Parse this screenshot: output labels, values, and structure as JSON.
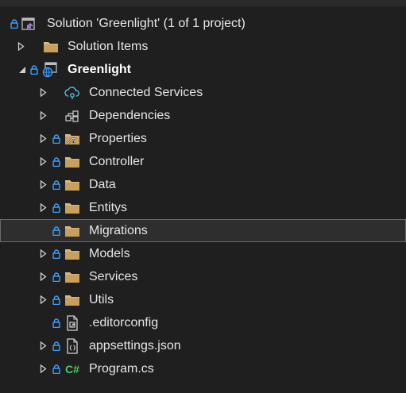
{
  "colors": {
    "background": "#1f1f1f",
    "folder": "#dcb67a",
    "lock": "#3f9fff",
    "csharp": "#4ec96b",
    "solution_accent": "#a87ce8",
    "text": "#e6e6e6"
  },
  "tree": {
    "solution": {
      "label": "Solution 'Greenlight' (1 of 1 project)",
      "icon": "solution-icon"
    },
    "solution_items": {
      "label": "Solution Items",
      "icon": "folder-icon"
    },
    "project": {
      "label": "Greenlight",
      "icon": "web-project-icon"
    },
    "children": [
      {
        "label": "Connected Services",
        "icon": "connected-services-icon"
      },
      {
        "label": "Dependencies",
        "icon": "dependencies-icon"
      },
      {
        "label": "Properties",
        "icon": "properties-folder-icon"
      },
      {
        "label": "Controller",
        "icon": "folder-icon"
      },
      {
        "label": "Data",
        "icon": "folder-icon"
      },
      {
        "label": "Entitys",
        "icon": "folder-icon"
      },
      {
        "label": "Migrations",
        "icon": "folder-icon"
      },
      {
        "label": "Models",
        "icon": "folder-icon"
      },
      {
        "label": "Services",
        "icon": "folder-icon"
      },
      {
        "label": "Utils",
        "icon": "folder-icon"
      },
      {
        "label": ".editorconfig",
        "icon": "editorconfig-file-icon"
      },
      {
        "label": "appsettings.json",
        "icon": "json-file-icon"
      },
      {
        "label": "Program.cs",
        "icon": "csharp-file-icon",
        "glyph": "C#"
      }
    ]
  }
}
